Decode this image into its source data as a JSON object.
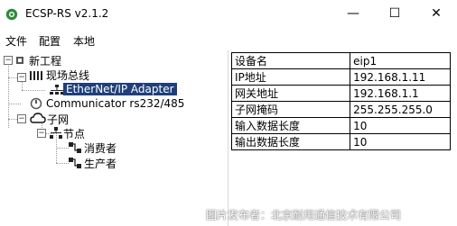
{
  "window": {
    "title": "ECSP-RS v2.1.2",
    "minimize": "—",
    "maximize": "☐",
    "close": "✕"
  },
  "menu": [
    "文件",
    "配置",
    "本地"
  ],
  "tree": {
    "root": "新工程",
    "fieldbus": "现场总线",
    "ethernet_ip": "EtherNet/IP Adapter",
    "communicator": "Communicator rs232/485",
    "subnet": "子网",
    "nodes": "节点",
    "consumer": "消费者",
    "producer": "生产者"
  },
  "properties": [
    {
      "key": "设备名",
      "value": "eip1"
    },
    {
      "key": "IP地址",
      "value": "192.168.1.11"
    },
    {
      "key": "网关地址",
      "value": "192.168.1.1"
    },
    {
      "key": "子网掩码",
      "value": "255.255.255.0"
    },
    {
      "key": "输入数据长度",
      "value": "10"
    },
    {
      "key": "输出数据长度",
      "value": "10"
    }
  ],
  "watermark": "图片发布者：北京耐用通信技术有限公司",
  "colors": {
    "selection": "#1f3f7a",
    "text": "#000000"
  }
}
